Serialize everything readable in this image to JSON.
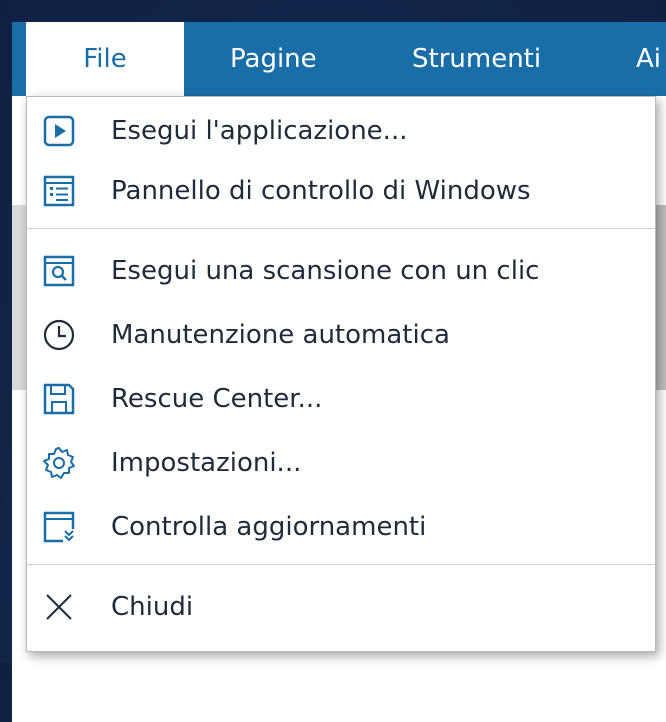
{
  "menubar": {
    "items": [
      {
        "label": "File"
      },
      {
        "label": "Pagine"
      },
      {
        "label": "Strumenti"
      },
      {
        "label": "Ai"
      }
    ]
  },
  "file_menu": {
    "items": [
      {
        "label": "Esegui l'applicazione...",
        "icon": "play-icon"
      },
      {
        "label": "Pannello di controllo di Windows",
        "icon": "control-panel-icon"
      },
      {
        "label": "Esegui una scansione con un clic",
        "icon": "scan-icon"
      },
      {
        "label": "Manutenzione automatica",
        "icon": "clock-icon"
      },
      {
        "label": "Rescue Center...",
        "icon": "save-icon"
      },
      {
        "label": "Impostazioni...",
        "icon": "gear-icon"
      },
      {
        "label": "Controlla aggiornamenti",
        "icon": "update-icon"
      },
      {
        "label": "Chiudi",
        "icon": "close-icon"
      }
    ]
  },
  "colors": {
    "accent": "#1a6ea8",
    "menu_text": "#1f2b3a",
    "background": "#13284f"
  }
}
